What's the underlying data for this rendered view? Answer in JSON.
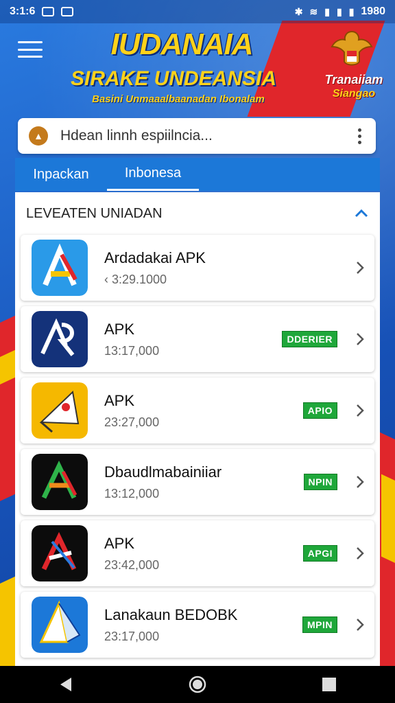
{
  "status_bar": {
    "time": "3:1:6",
    "right_text": "1980"
  },
  "header": {
    "title_line1": "IUDANAIA",
    "title_line2": "SIRAKE UNDEANSIA",
    "title_line3": "Basini Unmaaalbaanadan Ibonalam",
    "badge_line1": "Tranaiiam",
    "badge_line2": "Siangao"
  },
  "search": {
    "placeholder": "Hdean linnh espiilncia..."
  },
  "tabs": [
    {
      "label": "Inpackan",
      "active": false
    },
    {
      "label": "Inbonesa",
      "active": true
    }
  ],
  "section": {
    "title": "LEVEATEN UNIADAN"
  },
  "apps": [
    {
      "name": "Ardadakai APK",
      "size": "‹ 3:29.1000",
      "badge": ""
    },
    {
      "name": "APK",
      "size": "13:17,000",
      "badge": "DDERIER"
    },
    {
      "name": "APK",
      "size": "23:27,000",
      "badge": "APIO"
    },
    {
      "name": "Dbaudlmabainiiar",
      "size": "13:12,000",
      "badge": "NPIN"
    },
    {
      "name": "APK",
      "size": "23:42,000",
      "badge": "APGI"
    },
    {
      "name": "Lanakaun BEDOBK",
      "size": "23:17,000",
      "badge": "MPIN"
    }
  ],
  "colors": {
    "accent": "#1c78d8",
    "badge_green": "#1fa73a",
    "title_yellow": "#ffd21a"
  }
}
